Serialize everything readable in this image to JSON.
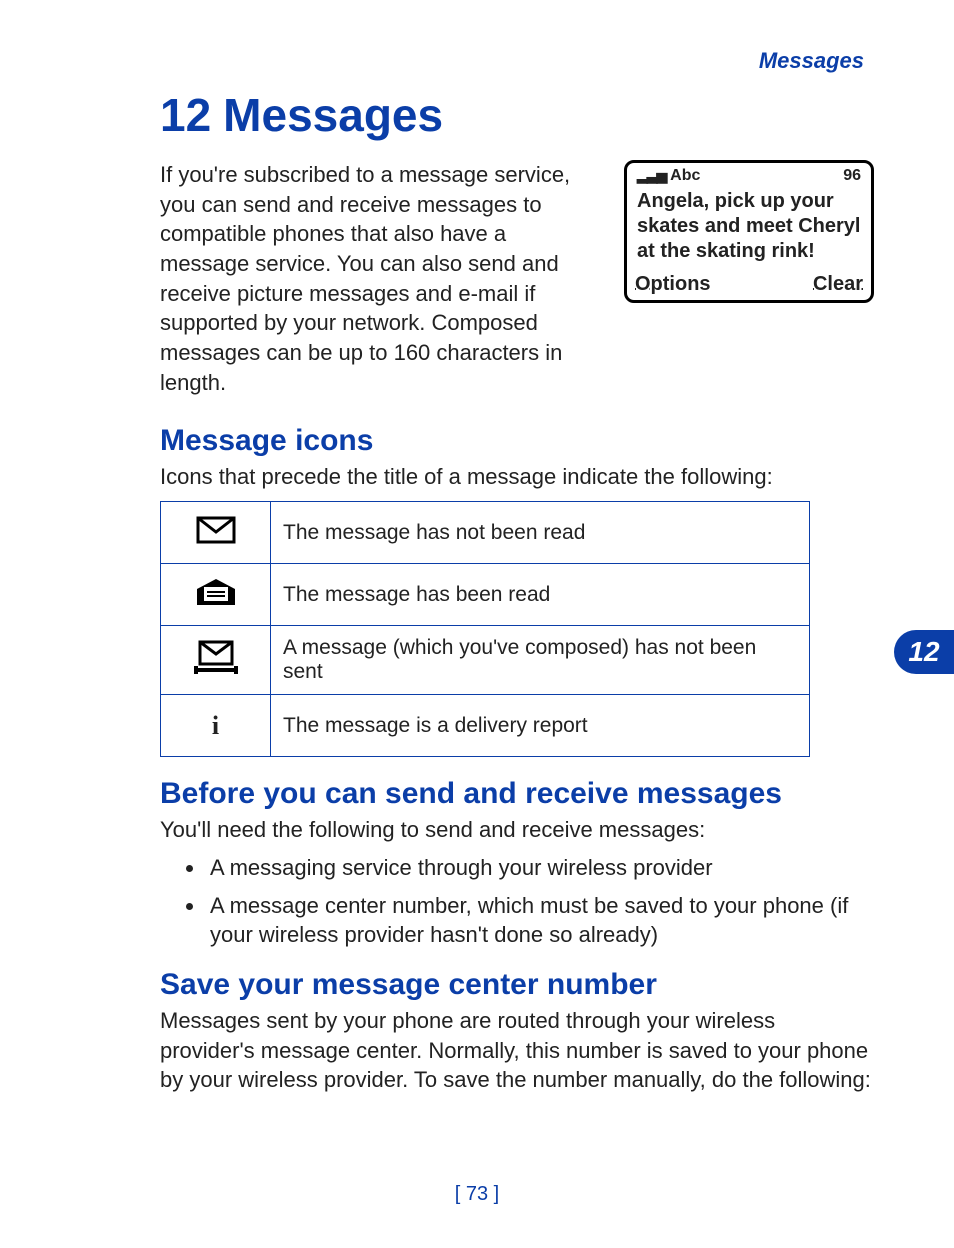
{
  "running_head": "Messages",
  "chapter": {
    "number": "12",
    "title": "Messages",
    "tab": "12"
  },
  "intro": "If you're subscribed to a message service, you can send and receive messages to compatible phones that also have a message service. You can also send and receive picture messages and e-mail if supported by your network. Composed messages can be up to 160 characters in length.",
  "phone_screen": {
    "signal_icon": "📶",
    "mode": "Abc",
    "chars_left": "96",
    "message": "Angela, pick up your skates and meet Cheryl at the skating rink!",
    "soft_left": "Options",
    "soft_right": "Clear"
  },
  "section_icons": {
    "heading": "Message icons",
    "lead": "Icons that precede the title of a message indicate the following:",
    "rows": [
      {
        "icon": "unread-icon",
        "desc": "The message has not been read"
      },
      {
        "icon": "read-icon",
        "desc": "The message has been read"
      },
      {
        "icon": "unsent-icon",
        "desc": "A message (which you've composed) has not been sent"
      },
      {
        "icon": "info-icon",
        "desc": "The message is a delivery report"
      }
    ]
  },
  "section_before": {
    "heading": "Before you can send and receive messages",
    "lead": "You'll need the following to send and receive messages:",
    "items": [
      "A messaging service through your wireless provider",
      "A message center number, which must be saved to your phone (if your wireless provider hasn't done so already)"
    ]
  },
  "section_save": {
    "heading": "Save your message center number",
    "body": "Messages sent by your phone are routed through your wireless provider's message center. Normally, this number is saved to your phone by your wireless provider. To save the number manually, do the following:"
  },
  "page_number": "[ 73 ]"
}
